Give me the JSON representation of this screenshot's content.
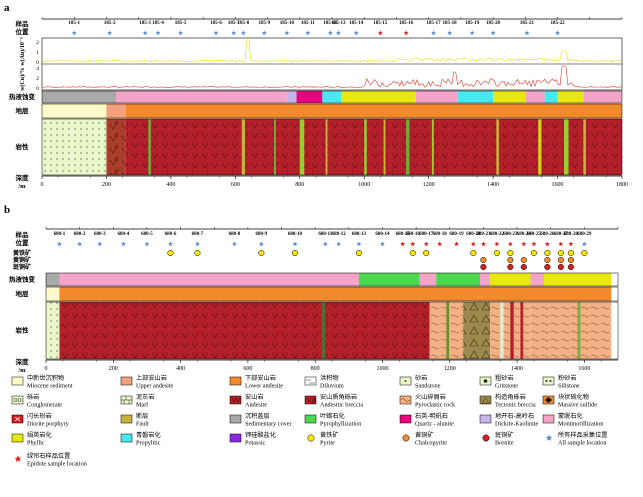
{
  "panels": {
    "a": {
      "letter": "a",
      "row_labels": {
        "samples": "样品\n位置",
        "assay": "w(Cu)/% w(Au)/10⁻⁶",
        "alteration": "热液蚀变",
        "stratum": "地层",
        "lithology": "岩性",
        "depth": "深度\n/m"
      },
      "axis_ticks": [
        "0",
        "200",
        "400",
        "600",
        "800",
        "1000",
        "1200",
        "1400",
        "1600",
        "1800"
      ],
      "axis_max": 1800,
      "sample_labels": [
        "185-1",
        "185-2",
        "185-3",
        "185-4",
        "185-5",
        "185-6",
        "185-7",
        "185-8",
        "185-9",
        "185-10",
        "185-11",
        "185-12",
        "185-13",
        "185-14",
        "185-15",
        "185-16",
        "185-17",
        "185-18",
        "185-19",
        "185-20",
        "185-21",
        "185-22"
      ],
      "sample_depths": [
        100,
        210,
        320,
        360,
        430,
        540,
        595,
        625,
        690,
        760,
        825,
        895,
        920,
        975,
        1050,
        1130,
        1215,
        1265,
        1335,
        1400,
        1505,
        1600
      ],
      "epidote_indices": [
        14,
        15
      ],
      "assay_ticks": [
        "2",
        "1",
        "0",
        "4",
        "2",
        "0"
      ],
      "alteration_segments": [
        {
          "from": 0,
          "to": 230,
          "color": "#a9a9a9"
        },
        {
          "from": 230,
          "to": 760,
          "color": "#f4a3c9"
        },
        {
          "from": 760,
          "to": 790,
          "color": "#c8b4e8"
        },
        {
          "from": 790,
          "to": 870,
          "color": "#e8007f"
        },
        {
          "from": 870,
          "to": 930,
          "color": "#48e8f0"
        },
        {
          "from": 930,
          "to": 1160,
          "color": "#e8e80f"
        },
        {
          "from": 1160,
          "to": 1290,
          "color": "#f4a3c9"
        },
        {
          "from": 1290,
          "to": 1400,
          "color": "#48e8f0"
        },
        {
          "from": 1400,
          "to": 1500,
          "color": "#e8e80f"
        },
        {
          "from": 1500,
          "to": 1560,
          "color": "#f4a3c9"
        },
        {
          "from": 1560,
          "to": 1600,
          "color": "#48e8f0"
        },
        {
          "from": 1600,
          "to": 1680,
          "color": "#e8e80f"
        },
        {
          "from": 1680,
          "to": 1800,
          "color": "#f4a3c9"
        }
      ],
      "stratum_segments": [
        {
          "from": 0,
          "to": 200,
          "color": "#fffac8"
        },
        {
          "from": 200,
          "to": 260,
          "color": "#f4a07a"
        },
        {
          "from": 260,
          "to": 1800,
          "color": "#f28a2c"
        }
      ],
      "lithology_segments": [
        {
          "from": 0,
          "to": 200,
          "color": "#e9f7c8",
          "pattern": "sand"
        },
        {
          "from": 200,
          "to": 260,
          "color": "#a93f2a",
          "pattern": "breccia"
        },
        {
          "from": 260,
          "to": 1800,
          "color": "#b3202a",
          "pattern": "andesite"
        }
      ],
      "lithology_bands": [
        {
          "at": 330,
          "w": 8,
          "color": "#6fae3a"
        },
        {
          "at": 620,
          "w": 10,
          "color": "#c9b23a"
        },
        {
          "at": 720,
          "w": 6,
          "color": "#6fae3a"
        },
        {
          "at": 800,
          "w": 14,
          "color": "#9acd32"
        },
        {
          "at": 880,
          "w": 6,
          "color": "#c9b23a"
        },
        {
          "at": 1000,
          "w": 8,
          "color": "#9acd32"
        },
        {
          "at": 1060,
          "w": 6,
          "color": "#c9b23a"
        },
        {
          "at": 1130,
          "w": 10,
          "color": "#6fae3a"
        },
        {
          "at": 1210,
          "w": 6,
          "color": "#9acd32"
        },
        {
          "at": 1410,
          "w": 8,
          "color": "#c9b23a"
        },
        {
          "at": 1540,
          "w": 10,
          "color": "#d8d01f"
        },
        {
          "at": 1620,
          "w": 14,
          "color": "#9acd32"
        },
        {
          "at": 1680,
          "w": 8,
          "color": "#c9b23a"
        }
      ]
    },
    "b": {
      "letter": "b",
      "row_labels": {
        "samples": "样品\n位置",
        "minerals": "黄铁矿\n黄铜矿\n斑铜矿",
        "alteration": "热液蚀变",
        "stratum": "地层",
        "lithology": "岩性",
        "depth": "深度\n/m"
      },
      "axis_ticks": [
        "0",
        "200",
        "400",
        "600",
        "800",
        "1000",
        "1200",
        "1400",
        "1600"
      ],
      "axis_max": 1700,
      "sample_labels": [
        "680-1",
        "680-2",
        "680-3",
        "680-4",
        "680-5",
        "680-6",
        "680-7",
        "680-8",
        "680-9",
        "680-10",
        "680-11",
        "680-12",
        "680-13",
        "680-14",
        "680-15",
        "680-16",
        "680-17",
        "680-18",
        "680-19",
        "680-20",
        "680-21",
        "680-22",
        "680-23",
        "680-24",
        "680-25",
        "680-26",
        "680-27",
        "680-28",
        "680-29"
      ],
      "sample_depths": [
        40,
        100,
        160,
        230,
        300,
        370,
        450,
        560,
        640,
        740,
        830,
        870,
        930,
        1000,
        1060,
        1090,
        1130,
        1170,
        1220,
        1270,
        1300,
        1340,
        1380,
        1420,
        1450,
        1490,
        1530,
        1560,
        1600
      ],
      "epidote_indices": [
        14,
        15,
        16,
        17,
        18,
        19,
        20,
        21,
        22,
        23,
        24,
        25,
        26,
        27
      ],
      "pyrite_indices": [
        5,
        6,
        8,
        9,
        12,
        15,
        16,
        19,
        21,
        22,
        24,
        25,
        26,
        27,
        28
      ],
      "chalco_indices": [
        20,
        22,
        23,
        25,
        26,
        27
      ],
      "bornite_indices": [
        20,
        22,
        23,
        25,
        26,
        27
      ],
      "alteration_segments": [
        {
          "from": 0,
          "to": 40,
          "color": "#a9a9a9"
        },
        {
          "from": 40,
          "to": 930,
          "color": "#f4a3c9"
        },
        {
          "from": 930,
          "to": 1110,
          "color": "#4cd84c"
        },
        {
          "from": 1110,
          "to": 1160,
          "color": "#f4a3c9"
        },
        {
          "from": 1160,
          "to": 1290,
          "color": "#4cd84c"
        },
        {
          "from": 1290,
          "to": 1320,
          "color": "#f4a3c9"
        },
        {
          "from": 1320,
          "to": 1440,
          "color": "#e8e80f"
        },
        {
          "from": 1440,
          "to": 1480,
          "color": "#f4a3c9"
        },
        {
          "from": 1480,
          "to": 1680,
          "color": "#e8e80f"
        }
      ],
      "stratum_segments": [
        {
          "from": 0,
          "to": 40,
          "color": "#fffac8"
        },
        {
          "from": 40,
          "to": 1680,
          "color": "#f28a2c"
        }
      ],
      "lithology_segments": [
        {
          "from": 0,
          "to": 40,
          "color": "#e9f7c8",
          "pattern": "sand"
        },
        {
          "from": 40,
          "to": 1140,
          "color": "#b3202a",
          "pattern": "andesite"
        },
        {
          "from": 1140,
          "to": 1240,
          "color": "#f3b187",
          "pattern": "pyro"
        },
        {
          "from": 1240,
          "to": 1320,
          "color": "#9c8a4d",
          "pattern": "tect"
        },
        {
          "from": 1320,
          "to": 1440,
          "color": "#f3b187",
          "pattern": "pyro"
        },
        {
          "from": 1440,
          "to": 1680,
          "color": "#f3b187",
          "pattern": "pyro"
        }
      ],
      "lithology_bands": [
        {
          "at": 820,
          "w": 10,
          "color": "#556b2f"
        },
        {
          "at": 1190,
          "w": 8,
          "color": "#6b8e23"
        },
        {
          "at": 1350,
          "w": 10,
          "color": "#e0eccd"
        },
        {
          "at": 1380,
          "w": 10,
          "color": "#b3202a"
        },
        {
          "at": 1410,
          "w": 8,
          "color": "#b3202a"
        },
        {
          "at": 1580,
          "w": 8,
          "color": "#6fae3a"
        }
      ]
    }
  },
  "legend": {
    "items": [
      {
        "zh": "中新世沉积物",
        "en": "Miocene sediment",
        "swatch": "#fffac8",
        "kind": "plain"
      },
      {
        "zh": "上部安山岩",
        "en": "Upper andesite",
        "swatch": "#f4a07a",
        "kind": "plain"
      },
      {
        "zh": "下部安山岩",
        "en": "Lower andesite",
        "swatch": "#f28a2c",
        "kind": "plain"
      },
      {
        "zh": "洪积物",
        "en": "Diluvium",
        "swatch": "#ffffff",
        "kind": "dil"
      },
      {
        "zh": "砂岩",
        "en": "Sandstone",
        "swatch": "#e9f7c8",
        "kind": "dot"
      },
      {
        "zh": "粗砂岩",
        "en": "Gritstone",
        "swatch": "#e9f7c8",
        "kind": "bigdot"
      },
      {
        "zh": "粉砂岩",
        "en": "Siltstone",
        "swatch": "#e9f7c8",
        "kind": "dots2"
      },
      {
        "zh": "砾岩",
        "en": "Conglomerate",
        "swatch": "#e9f7c8",
        "kind": "circ"
      },
      {
        "zh": "泥灰岩",
        "en": "Marl",
        "swatch": "#e9f7c8",
        "kind": "brick"
      },
      {
        "zh": "安山岩",
        "en": "Andesite",
        "swatch": "#b3202a",
        "kind": "v"
      },
      {
        "zh": "安山质角砾岩",
        "en": "Andesitic breccia",
        "swatch": "#b3202a",
        "kind": "vtri"
      },
      {
        "zh": "火山碎屑岩",
        "en": "Pyroclastic rock",
        "swatch": "#f3b187",
        "kind": "wave"
      },
      {
        "zh": "构造角砾岩",
        "en": "Tectonic breccia",
        "swatch": "#9c8a4d",
        "kind": "tri"
      },
      {
        "zh": "块状硫化物",
        "en": "Massive sulfide",
        "swatch": "#f28a2c",
        "kind": "diamond"
      },
      {
        "zh": "闪长玢岩",
        "en": "Diorite porphyry",
        "swatch": "#d21f1f",
        "kind": "cross"
      },
      {
        "zh": "断层",
        "en": "Fault",
        "swatch": "#c9b23a",
        "kind": "plain"
      },
      {
        "zh": "沉积盖层",
        "en": "Sedimentary cover",
        "swatch": "#a9a9a9",
        "kind": "plain"
      },
      {
        "zh": "叶蜡石化",
        "en": "Pyrophyllization",
        "swatch": "#4cd84c",
        "kind": "plain"
      },
      {
        "zh": "石英-明矾石",
        "en": "Quartz - alunite",
        "swatch": "#e8007f",
        "kind": "plain"
      },
      {
        "zh": "地开石-高岭石",
        "en": "Dickite-Kaolinite",
        "swatch": "#c8b4e8",
        "kind": "plain"
      },
      {
        "zh": "蒙脱石化",
        "en": "Montmorillization",
        "swatch": "#f4a3c9",
        "kind": "plain"
      },
      {
        "zh": "绢英岩化",
        "en": "Phyllic",
        "swatch": "#e8e80f",
        "kind": "plain"
      },
      {
        "zh": "青磐岩化",
        "en": "Propylitic",
        "swatch": "#48e8f0",
        "kind": "plain"
      },
      {
        "zh": "钾硅酸盐化",
        "en": "Potassic",
        "swatch": "#8a2be2",
        "kind": "plain"
      },
      {
        "zh": "黄铁矿",
        "en": "Pyrite",
        "swatch": "#ffe600",
        "kind": "ore"
      },
      {
        "zh": "黄铜矿",
        "en": "Chalcopyrite",
        "swatch": "#f28a2c",
        "kind": "ore"
      },
      {
        "zh": "斑铜矿",
        "en": "Bornite",
        "swatch": "#d21f1f",
        "kind": "ore"
      },
      {
        "zh": "所有样品采集位置",
        "en": "All sample location",
        "swatch": "#5b8fd8",
        "kind": "star"
      },
      {
        "zh": "绿帘石样品位置",
        "en": "Epidote sample location",
        "swatch": "#e02020",
        "kind": "redstar"
      }
    ]
  },
  "colors": {
    "blue_star": "#5b8fd8",
    "red_star": "#e02020",
    "cu_line": "#e23a2a",
    "au_line": "#e8e000"
  }
}
